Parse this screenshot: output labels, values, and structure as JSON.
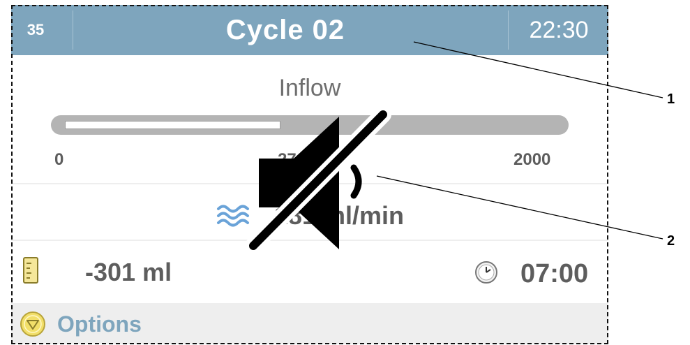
{
  "header": {
    "screen_number": "35",
    "title": "Cycle 02",
    "clock": "22:30"
  },
  "inflow": {
    "label": "Inflow",
    "scale_min": "0",
    "scale_mid": "27 ml",
    "scale_max": "2000",
    "progress_fraction": 0.44
  },
  "flow_rate": {
    "icon": "flow-waves-icon",
    "value": "181 ml/min"
  },
  "volume": {
    "icon": "beaker-icon",
    "value": "-301 ml"
  },
  "timer": {
    "icon": "clock-icon",
    "value": "07:00"
  },
  "options": {
    "icon": "down-triangle-circle-icon",
    "label": "Options"
  },
  "overlay": {
    "icon": "speaker-muted-icon"
  },
  "callouts": {
    "c1": "1",
    "c2": "2"
  },
  "colors": {
    "header": "#7ea5bd",
    "accent_blue": "#6aa3d8",
    "text_gray": "#5d5d5d",
    "options_yellow": "#f2df6a"
  }
}
